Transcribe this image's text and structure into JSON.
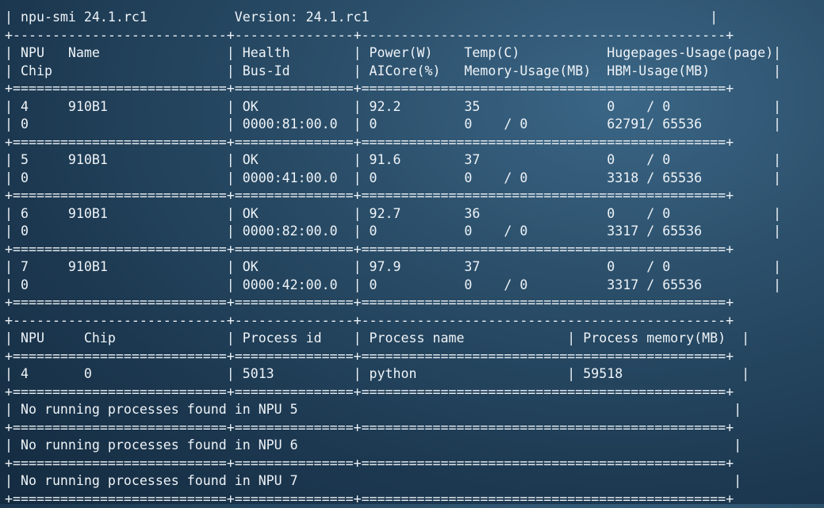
{
  "terminal": {
    "lines": [
      {
        "kind": "text",
        "text": "| npu-smi 24.1.rc1           Version: 24.1.rc1                                           |"
      },
      {
        "kind": "dash",
        "text": "+---------------------------+---------------+----------------------------------------------+"
      },
      {
        "kind": "text",
        "text": "| NPU   Name                | Health        | Power(W)    Temp(C)           Hugepages-Usage(page)|"
      },
      {
        "kind": "text",
        "text": "| Chip                      | Bus-Id        | AICore(%)   Memory-Usage(MB)  HBM-Usage(MB)        |"
      },
      {
        "kind": "equal",
        "text": "+===========================+===============+==============================================+"
      },
      {
        "kind": "text",
        "text": "| 4     910B1               | OK            | 92.2        35                0    / 0             |"
      },
      {
        "kind": "text",
        "text": "| 0                         | 0000:81:00.0  | 0           0    / 0          62791/ 65536         |"
      },
      {
        "kind": "equal",
        "text": "+===========================+===============+==============================================+"
      },
      {
        "kind": "text",
        "text": "| 5     910B1               | OK            | 91.6        37                0    / 0             |"
      },
      {
        "kind": "text",
        "text": "| 0                         | 0000:41:00.0  | 0           0    / 0          3318 / 65536         |"
      },
      {
        "kind": "equal",
        "text": "+===========================+===============+==============================================+"
      },
      {
        "kind": "text",
        "text": "| 6     910B1               | OK            | 92.7        36                0    / 0             |"
      },
      {
        "kind": "text",
        "text": "| 0                         | 0000:82:00.0  | 0           0    / 0          3317 / 65536         |"
      },
      {
        "kind": "equal",
        "text": "+===========================+===============+==============================================+"
      },
      {
        "kind": "text",
        "text": "| 7     910B1               | OK            | 97.9        37                0    / 0             |"
      },
      {
        "kind": "text",
        "text": "| 0                         | 0000:42:00.0  | 0           0    / 0          3317 / 65536         |"
      },
      {
        "kind": "equal",
        "text": "+===========================+===============+==============================================+"
      },
      {
        "kind": "dash",
        "text": "+---------------------------+---------------+----------------------------------------------+"
      },
      {
        "kind": "text",
        "text": "| NPU     Chip              | Process id    | Process name             | Process memory(MB)  |"
      },
      {
        "kind": "equal",
        "text": "+===========================+===============+==============================================+"
      },
      {
        "kind": "text",
        "text": "| 4       0                 | 5013          | python                   | 59518               |"
      },
      {
        "kind": "equal",
        "text": "+===========================+===============+==============================================+"
      },
      {
        "kind": "text",
        "text": "| No running processes found in NPU 5                                                       |"
      },
      {
        "kind": "equal",
        "text": "+===========================+===============+==============================================+"
      },
      {
        "kind": "text",
        "text": "| No running processes found in NPU 6                                                       |"
      },
      {
        "kind": "equal",
        "text": "+===========================+===============+==============================================+"
      },
      {
        "kind": "text",
        "text": "| No running processes found in NPU 7                                                       |"
      },
      {
        "kind": "equal",
        "text": "+===========================+===============+==============================================+"
      }
    ]
  },
  "colors": {
    "text": "#eef3f7",
    "background_center": "#3b6686",
    "background_edge": "#142b40"
  }
}
